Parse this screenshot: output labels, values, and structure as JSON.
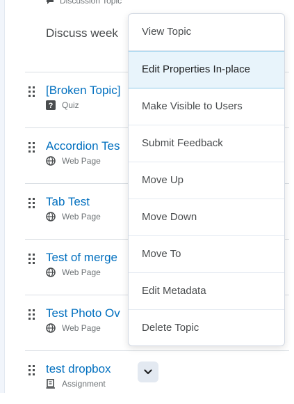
{
  "list": {
    "top_item": {
      "subtype": "Discussion Topic",
      "icon": "discussion-icon"
    },
    "discuss_text": "Discuss week",
    "items": [
      {
        "title": "[Broken Topic]",
        "type": "Quiz",
        "icon": "quiz-icon"
      },
      {
        "title": "Accordion Tes",
        "type": "Web Page",
        "icon": "web-page-icon"
      },
      {
        "title": "Tab Test",
        "type": "Web Page",
        "icon": "web-page-icon"
      },
      {
        "title": "Test of merge",
        "type": "Web Page",
        "icon": "web-page-icon"
      },
      {
        "title": "Test Photo Ov",
        "type": "Web Page",
        "icon": "web-page-icon"
      },
      {
        "title": "test dropbox",
        "type": "Assignment",
        "icon": "assignment-icon"
      }
    ]
  },
  "menu": {
    "items": [
      {
        "label": "View Topic"
      },
      {
        "label": "Edit Properties In-place",
        "active": true
      },
      {
        "label": "Make Visible to Users"
      },
      {
        "label": "Submit Feedback"
      },
      {
        "label": "Move Up"
      },
      {
        "label": "Move Down"
      },
      {
        "label": "Move To"
      },
      {
        "label": "Edit Metadata"
      },
      {
        "label": "Delete Topic"
      }
    ]
  },
  "colors": {
    "link": "#006fbf",
    "active_bg": "#e8f4fb",
    "active_border": "#8ccae9"
  }
}
